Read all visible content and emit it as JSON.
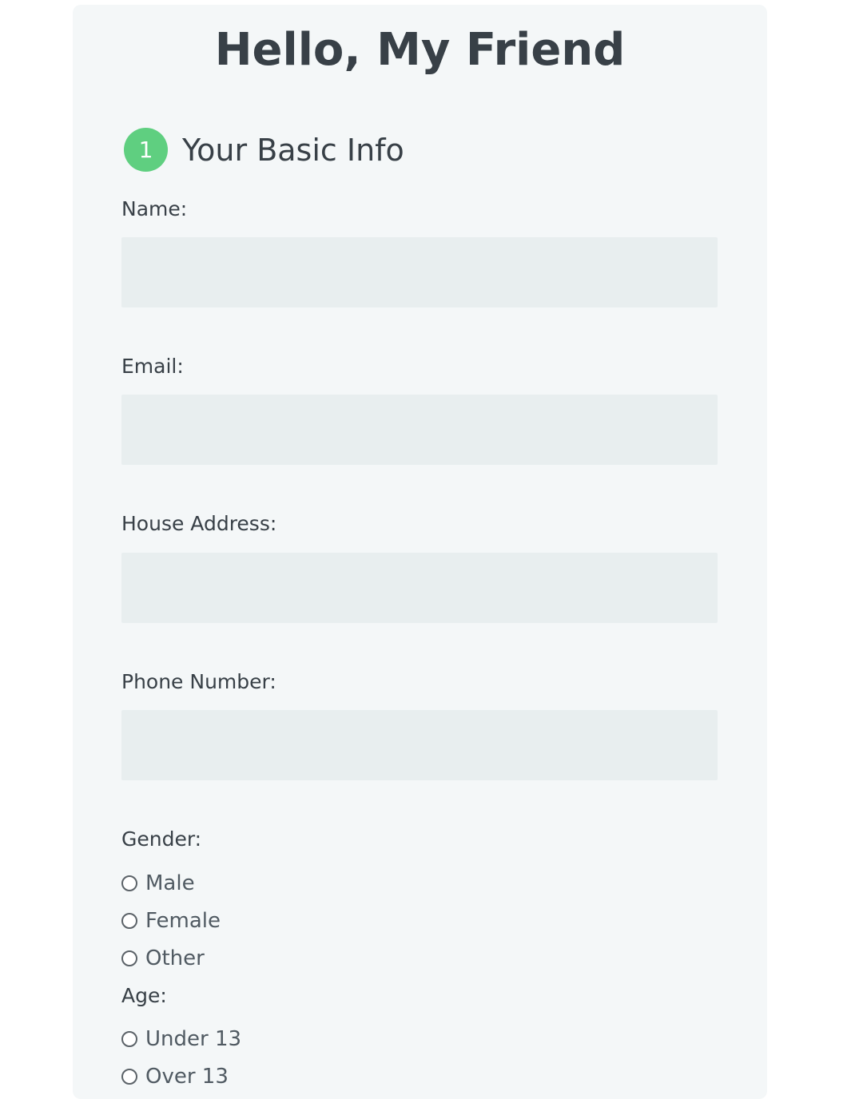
{
  "form": {
    "title": "Hello, My Friend",
    "section": {
      "number": "1",
      "heading": "Your Basic Info"
    },
    "fields": {
      "name_label": "Name:",
      "email_label": "Email:",
      "address_label": "House Address:",
      "phone_label": "Phone Number:"
    },
    "gender": {
      "label": "Gender:",
      "options": [
        "Male",
        "Female",
        "Other"
      ]
    },
    "age": {
      "label": "Age:",
      "options": [
        "Under 13",
        "Over 13"
      ]
    }
  },
  "colors": {
    "card_background": "#f4f7f8",
    "field_background": "#e8eeef",
    "step_badge": "#5fcf80",
    "text": "#384047"
  }
}
